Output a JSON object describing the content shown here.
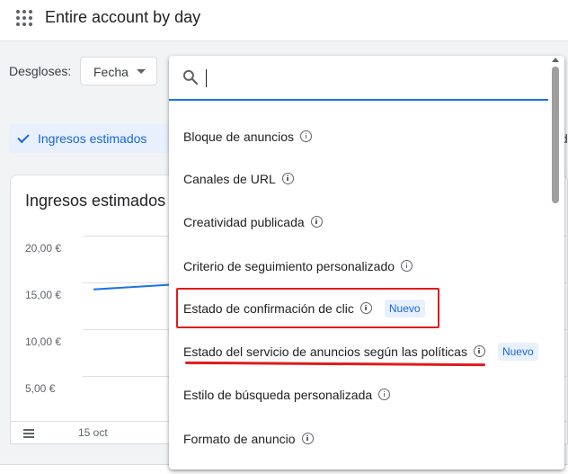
{
  "header": {
    "title": "Entire account by day"
  },
  "breakdowns": {
    "label": "Desgloses:",
    "selected": "Fecha"
  },
  "metric_chip": {
    "label": "Ingresos estimados"
  },
  "right_edge_letter": "d",
  "chart_card": {
    "title": "Ingresos estimados",
    "y_ticks": [
      "20,00 €",
      "15,00 €",
      "10,00 €",
      "5,00 €"
    ],
    "x_ticks": [
      "15 oct"
    ]
  },
  "chart_data": {
    "type": "line",
    "title": "Ingresos estimados",
    "xlabel": "",
    "ylabel": "",
    "x": [
      "",
      "15 oct"
    ],
    "series": [
      {
        "values": [
          15.5,
          16.0
        ]
      }
    ],
    "ylim": [
      0,
      22
    ]
  },
  "dropdown": {
    "search_value": "",
    "options": [
      {
        "label": "Bloque de anuncios",
        "badge": ""
      },
      {
        "label": "Canales de URL",
        "badge": ""
      },
      {
        "label": "Creatividad publicada",
        "badge": ""
      },
      {
        "label": "Criterio de seguimiento personalizado",
        "badge": ""
      },
      {
        "label": "Estado de confirmación de clic",
        "badge": "Nuevo"
      },
      {
        "label": "Estado del servicio de anuncios según las políticas",
        "badge": "Nuevo"
      },
      {
        "label": "Estilo de búsqueda personalizada",
        "badge": ""
      },
      {
        "label": "Formato de anuncio",
        "badge": ""
      }
    ]
  },
  "colors": {
    "accent": "#1a73e8",
    "chip_bg": "#e8f0fe",
    "annotation": "#e01b1b"
  },
  "icons": {
    "apps": "apps-grid-icon",
    "search": "search-icon",
    "info": "info-icon",
    "legend": "legend-icon",
    "check": "check-icon",
    "caret": "caret-down-icon"
  }
}
